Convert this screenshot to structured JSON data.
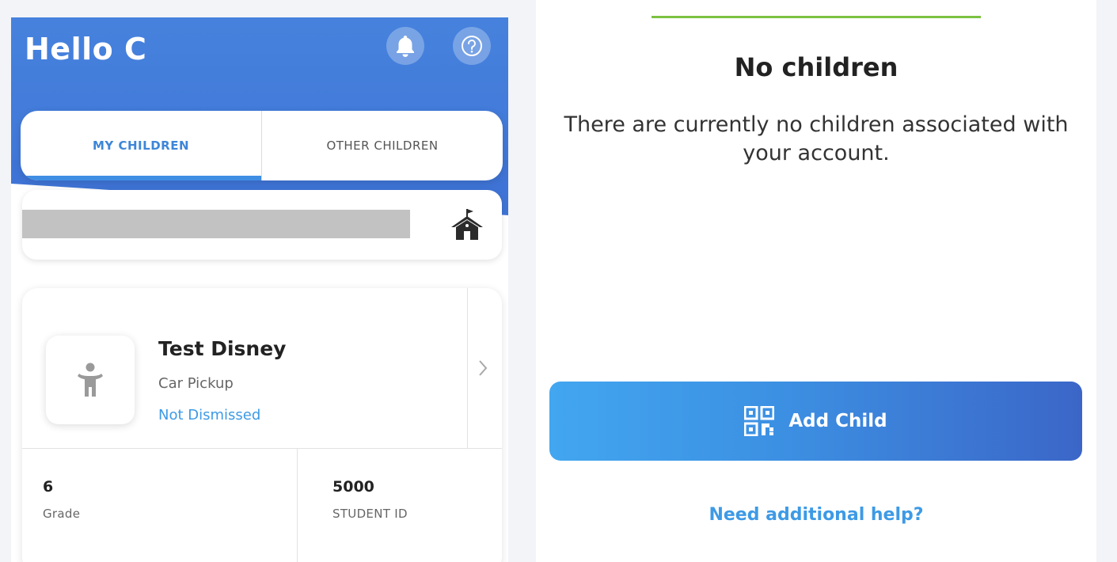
{
  "colors": {
    "header_blue": "#4682dd",
    "accent_blue": "#3d9ae6",
    "button_gradient_start": "#42a6f0",
    "button_gradient_end": "#3b66c8",
    "progress_green": "#7cc242"
  },
  "left_screen": {
    "greeting": "Hello C",
    "header_icons": [
      "bell-icon",
      "help-circle-icon"
    ],
    "tabs": [
      {
        "label": "MY CHILDREN",
        "selected": true
      },
      {
        "label": "OTHER CHILDREN",
        "selected": false
      }
    ],
    "school_card": {
      "icon": "school-icon"
    },
    "child_card": {
      "name": "Test Disney",
      "pickup_type": "Car Pickup",
      "status": "Not Dismissed",
      "grade_value": "6",
      "grade_label": "Grade",
      "student_id_value": "5000",
      "student_id_label": "STUDENT ID"
    }
  },
  "right_screen": {
    "title": "No children",
    "message": "There are currently no children associated with your account.",
    "add_child_label": "Add Child",
    "help_link": "Need additional help?"
  }
}
